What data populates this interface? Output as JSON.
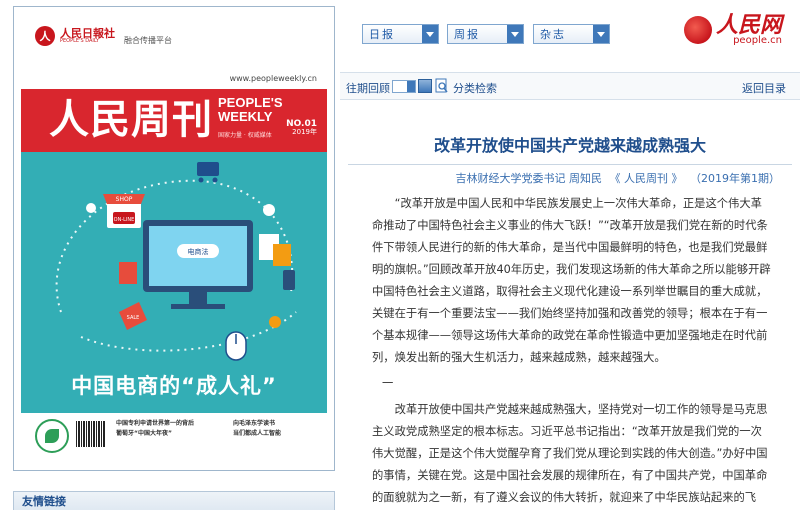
{
  "cover": {
    "logo_mark": "人",
    "logo_cn": "人民日報社",
    "logo_en": "PEOPLE'S DAILY",
    "logo_sub": "融合传播平台",
    "url": "www.peopleweekly.cn",
    "title": "人民周刊",
    "title_en_1": "PEOPLE'S",
    "title_en_2": "WEEKLY",
    "issue_no": "NO.01",
    "issue_year": "2019年",
    "tagline": "国家力量 · 权威媒体",
    "art_shop": "SHOP",
    "art_online": "ON-LINE",
    "art_screen": "电商法",
    "art_sale": "SALE",
    "headline": "中国电商的“成人礼”",
    "foot_mid_1": "中国专利申请世界第一的背后",
    "foot_mid_2": "葡萄牙“中国大年夜”",
    "foot_right_1": "向毛泽东学读书",
    "foot_right_2": "当们都成人工智能"
  },
  "sidebar": {
    "friend_links": "友情链接"
  },
  "selectors": {
    "daily": "日报",
    "weekly": "周报",
    "magazine": "杂志"
  },
  "brand": {
    "cn": "人民网",
    "en": "people.cn"
  },
  "nav": {
    "past_review": "往期回顾",
    "category_search": "分类检索",
    "back_to_toc": "返回目录"
  },
  "article": {
    "title": "改革开放使中国共产党越来越成熟强大",
    "author": "吉林财经大学党委书记  周知民",
    "source": "《 人民周刊 》",
    "issue": "（2019年第1期）",
    "paragraphs": [
      "“改革开放是中国人民和中华民族发展史上一次伟大革命，正是这个伟大革命推动了中国特色社会主义事业的伟大飞跃！”“改革开放是我们党在新的时代条件下带领人民进行的新的伟大革命，是当代中国最鲜明的特色，也是我们党最鲜明的旗帜。”回顾改革开放40年历史，我们发现这场新的伟大革命之所以能够开辟中国特色社会主义道路，取得社会主义现代化建设一系列举世瞩目的重大成就，关键在于有一个重要法宝——我们始终坚持加强和改善党的领导；根本在于有一个基本规律——领导这场伟大革命的政党在革命性锻造中更加坚强地走在时代前列，焕发出新的强大生机活力，越来越成熟，越来越强大。",
      "一",
      "改革开放使中国共产党越来越成熟强大，坚持党对一切工作的领导是马克思主义政党成熟坚定的根本标志。习近平总书记指出：“改革开放是我们党的一次伟大觉醒，正是这个伟大觉醒孕育了我们党从理论到实践的伟大创造。”办好中国的事情，关键在党。这是中国社会发展的规律所在，有了中国共产党，中国革命的面貌就为之一新，有了遵义会议的伟大转折，就迎来了中华民族站起来的飞跃，有了这一次伟大"
    ]
  },
  "colors": {
    "brand_red": "#c8161d",
    "link_blue": "#1f4e8c",
    "cover_teal": "#33aeb5"
  }
}
